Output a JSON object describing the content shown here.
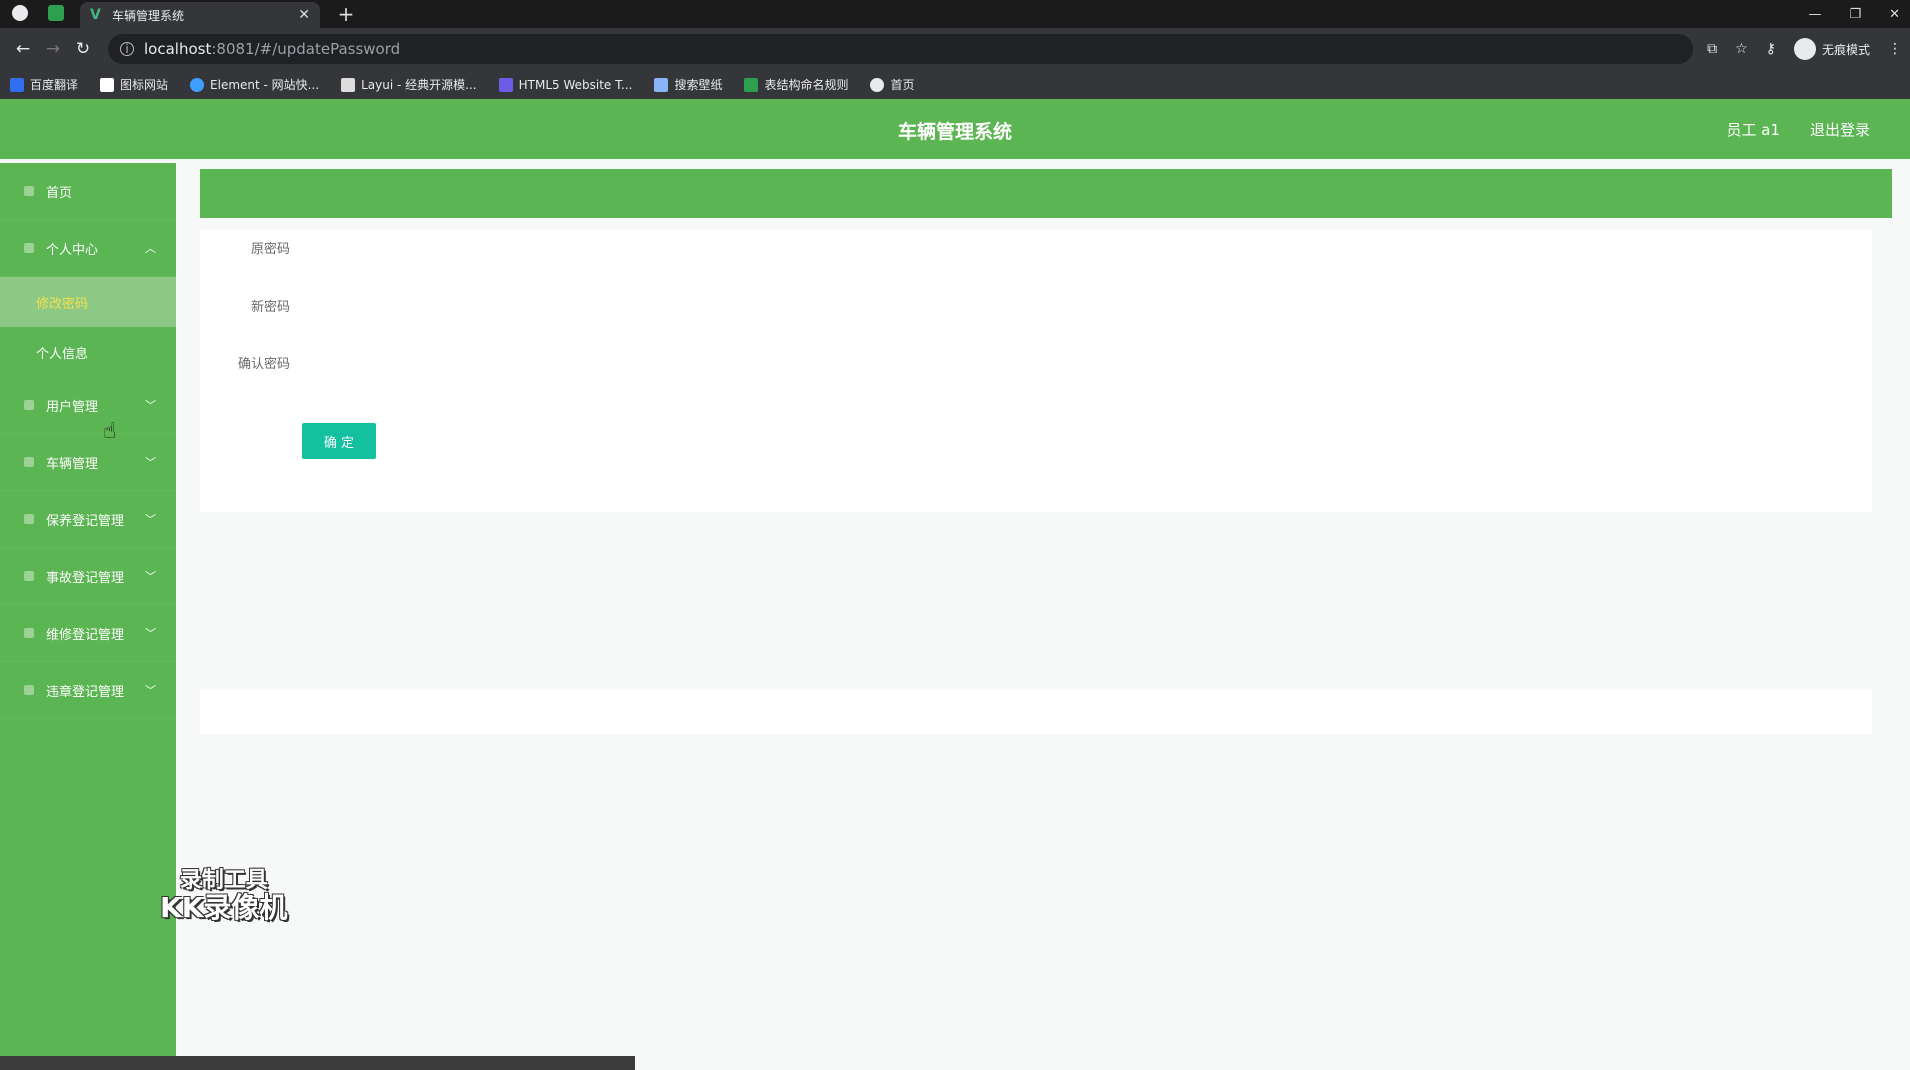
{
  "browser": {
    "tab_title": "车辆管理系统",
    "url_host": "localhost",
    "url_rest": ":8081/#/updatePassword",
    "incognito_label": "无痕模式",
    "bookmarks": [
      {
        "label": "百度翻译",
        "color": "#2f6ff0"
      },
      {
        "label": "图标网站",
        "color": "#ffffff"
      },
      {
        "label": "Element - 网站快...",
        "color": "#409eff"
      },
      {
        "label": "Layui - 经典开源模...",
        "color": "#dddddd"
      },
      {
        "label": "HTML5 Website T...",
        "color": "#6d5ce8"
      },
      {
        "label": "搜索壁纸",
        "color": "#8ab4f8"
      },
      {
        "label": "表结构命名规则",
        "color": "#2e9e4f"
      },
      {
        "label": "首页",
        "color": "#e8eaed"
      }
    ]
  },
  "app": {
    "title": "车辆管理系统",
    "user": "员工 a1",
    "logout": "退出登录",
    "accent": "#5cb553",
    "button_color": "#13c1a0"
  },
  "sidebar": {
    "items": [
      {
        "label": "首页"
      },
      {
        "label": "个人中心",
        "expanded": true
      },
      {
        "label": "用户管理"
      },
      {
        "label": "车辆管理"
      },
      {
        "label": "保养登记管理"
      },
      {
        "label": "事故登记管理"
      },
      {
        "label": "维修登记管理"
      },
      {
        "label": "违章登记管理"
      }
    ],
    "sub": [
      {
        "label": "修改密码",
        "active": true
      },
      {
        "label": "个人信息"
      }
    ]
  },
  "form": {
    "old_password_label": "原密码",
    "new_password_label": "新密码",
    "confirm_password_label": "确认密码",
    "submit_label": "确 定"
  },
  "watermark": {
    "line1": "录制工具",
    "line2": "KK录像机"
  }
}
